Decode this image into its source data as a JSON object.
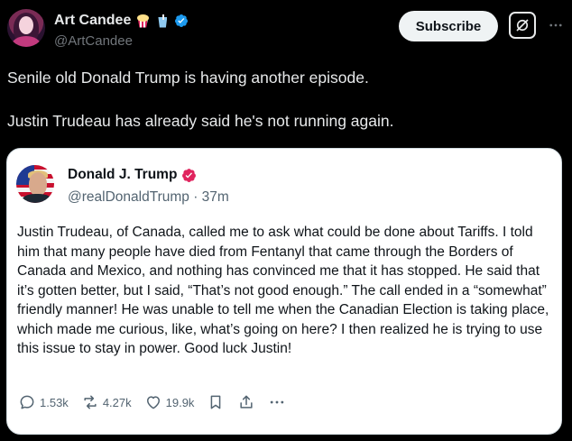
{
  "author": {
    "display_name": "Art Candee",
    "handle": "@ArtCandee"
  },
  "header": {
    "subscribe_label": "Subscribe"
  },
  "tweet": {
    "paragraphs": [
      "Senile old Donald Trump is having another episode.",
      "Justin Trudeau has already said he's not running again."
    ]
  },
  "quote": {
    "display_name": "Donald J. Trump",
    "handle_time": "@realDonaldTrump · 37m",
    "text": "Justin Trudeau, of Canada, called me to ask what could be done about Tariffs. I told him that many people have died from Fentanyl that came through the Borders of Canada and Mexico, and nothing has convinced me that it has stopped. He said that it’s gotten better, but I said, “That’s not good enough.” The call ended in a “somewhat” friendly manner! He was unable to tell me when the Canadian Election is taking place, which made me curious, like, what’s going on here? I then realized he is trying to use this issue to stay in power. Good luck Justin!",
    "actions": {
      "replies": "1.53k",
      "reposts": "4.27k",
      "likes": "19.9k"
    },
    "accent_color": "#e0245e"
  },
  "icons": [
    "popcorn-icon",
    "cup-icon",
    "verified-badge-icon",
    "grok-icon",
    "more-icon",
    "reply-icon",
    "repost-icon",
    "like-icon",
    "bookmark-icon",
    "share-icon",
    "more-icon"
  ],
  "colors": {
    "background": "#000000",
    "verified_blue": "#1d9bf0",
    "quote_background": "#ffffff"
  }
}
